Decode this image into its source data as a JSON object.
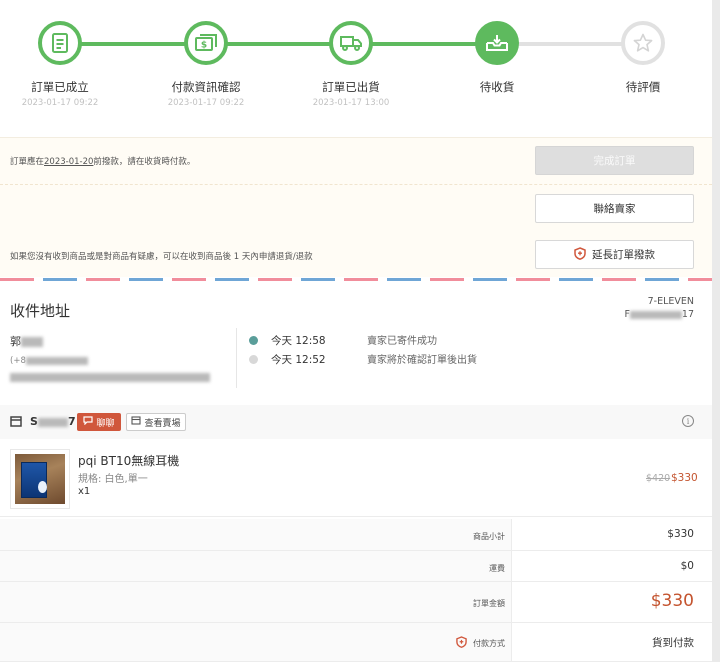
{
  "steps": [
    {
      "label": "訂單已成立",
      "date": "2023-01-17 09:22",
      "state": "done",
      "icon": "receipt-icon"
    },
    {
      "label": "付款資訊確認",
      "date": "2023-01-17 09:22",
      "state": "done",
      "icon": "money-icon"
    },
    {
      "label": "訂單已出貨",
      "date": "2023-01-17 13:00",
      "state": "done",
      "icon": "truck-icon"
    },
    {
      "label": "待收貨",
      "date": "",
      "state": "active",
      "icon": "inbox-icon"
    },
    {
      "label": "待評價",
      "date": "",
      "state": "todo",
      "icon": "star-icon"
    }
  ],
  "info": {
    "notice_prefix": "訂單應在",
    "notice_date": "2023-01-20",
    "notice_suffix": "前撥款，請在收貨時付款。",
    "refund_notice": "如果您沒有收到商品或是對商品有疑慮，可以在收到商品後 1 天內申請退貨/退款",
    "complete_button": "完成訂單",
    "contact_button": "聯絡賣家",
    "extend_button": "延長訂單撥款"
  },
  "address": {
    "title": "收件地址",
    "store_name": "7-ELEVEN",
    "store_code_prefix": "F",
    "store_code_suffix": "17",
    "name_prefix": "郭",
    "phone_prefix": "(+8",
    "tracking": [
      {
        "time": "今天 12:58",
        "desc": "賣家已寄件成功",
        "state": "current"
      },
      {
        "time": "今天 12:52",
        "desc": "賣家將於確認訂單後出貨",
        "state": "past"
      }
    ]
  },
  "shop": {
    "name_prefix": "S",
    "name_suffix": "7",
    "chat_button": "聊聊",
    "view_shop_button": "查看賣場",
    "info_symbol": "i"
  },
  "product": {
    "name": "pqi BT10無線耳機",
    "spec": "規格: 白色,單一",
    "qty": "x1",
    "original_price": "$420",
    "price": "$330"
  },
  "totals": [
    {
      "label": "商品小計",
      "value": "$330"
    },
    {
      "label": "運費",
      "value": "$0"
    },
    {
      "label": "訂單金額",
      "value": "$330",
      "emphasis": true
    },
    {
      "label": "付款方式",
      "value": "貨到付款",
      "icon": "shield-icon"
    }
  ],
  "colors": {
    "step_done": "#5eba5e",
    "step_todo": "#e1e1e1",
    "price": "#c4542f",
    "chat": "#d0573c"
  }
}
